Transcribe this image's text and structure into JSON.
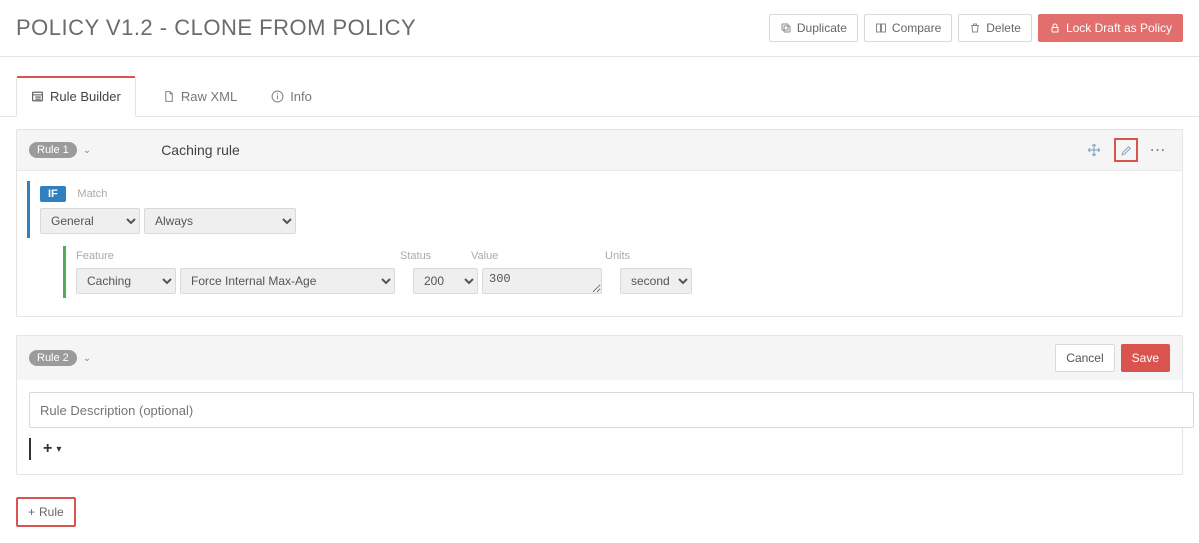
{
  "header": {
    "title": "POLICY V1.2 - CLONE FROM POLICY",
    "actions": {
      "duplicate": "Duplicate",
      "compare": "Compare",
      "delete": "Delete",
      "lock": "Lock Draft as Policy"
    }
  },
  "tabs": {
    "rule_builder": "Rule Builder",
    "raw_xml": "Raw XML",
    "info": "Info"
  },
  "rule1": {
    "badge": "Rule 1",
    "title": "Caching rule",
    "if_label": "IF",
    "match_label": "Match",
    "match_category": "General",
    "match_condition": "Always",
    "feature_label": "Feature",
    "status_label": "Status",
    "value_label": "Value",
    "units_label": "Units",
    "feature_category": "Caching",
    "feature_name": "Force Internal Max-Age",
    "status": "200",
    "value": "300",
    "units": "seconds"
  },
  "rule2": {
    "badge": "Rule 2",
    "cancel": "Cancel",
    "save": "Save",
    "description_placeholder": "Rule Description (optional)"
  },
  "footer": {
    "add_rule": "Rule"
  }
}
